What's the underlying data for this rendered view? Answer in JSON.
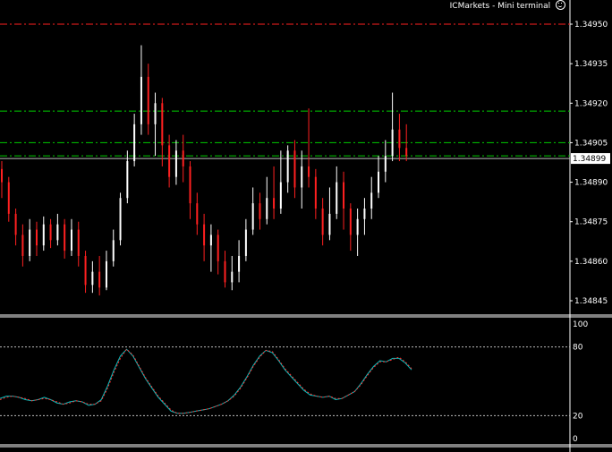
{
  "window": {
    "title": "ICMarkets - Mini terminal",
    "smiley_icon": "smiley-icon"
  },
  "colors": {
    "background": "#000000",
    "axis": "#ffffff",
    "bull": "#ffffff",
    "bear": "#ff2020",
    "resistance": "#ff2020",
    "support": "#00cc00",
    "current_price_line": "#bbbbbb",
    "osc_main": "#00c0c0",
    "osc_signal": "#ff3030",
    "osc_levels": "#bbbbbb"
  },
  "chart_data": [
    {
      "type": "candlestick",
      "price_axis_labels": [
        "1.34950",
        "1.34935",
        "1.34920",
        "1.34905",
        "1.34890",
        "1.34875",
        "1.34860",
        "1.34845"
      ],
      "current_price": "1.34899",
      "ylim": [
        1.34842,
        1.3496
      ],
      "horizontal_levels": [
        {
          "price": 1.3495,
          "style": "dash-dot",
          "color": "resistance"
        },
        {
          "price": 1.34917,
          "style": "dash-dot",
          "color": "support"
        },
        {
          "price": 1.34905,
          "style": "dash-dot",
          "color": "support"
        },
        {
          "price": 1.349,
          "style": "dash-dot",
          "color": "support"
        },
        {
          "price": 1.34899,
          "style": "solid",
          "color": "current_price_line"
        }
      ],
      "candles": [
        [
          1.34895,
          1.3489,
          1.34898,
          1.34884
        ],
        [
          1.3489,
          1.34878,
          1.34892,
          1.34875
        ],
        [
          1.34878,
          1.3487,
          1.3488,
          1.34866
        ],
        [
          1.3487,
          1.34862,
          1.34874,
          1.34858
        ],
        [
          1.34862,
          1.34872,
          1.34876,
          1.3486
        ],
        [
          1.34872,
          1.34866,
          1.34875,
          1.34862
        ],
        [
          1.34866,
          1.34874,
          1.34877,
          1.34864
        ],
        [
          1.34874,
          1.34868,
          1.34876,
          1.34865
        ],
        [
          1.34868,
          1.34874,
          1.34878,
          1.34866
        ],
        [
          1.34874,
          1.34864,
          1.34876,
          1.34861
        ],
        [
          1.34864,
          1.34872,
          1.34876,
          1.34862
        ],
        [
          1.34872,
          1.34862,
          1.34875,
          1.34858
        ],
        [
          1.34862,
          1.34851,
          1.34864,
          1.34848
        ],
        [
          1.34851,
          1.34856,
          1.3486,
          1.34848
        ],
        [
          1.34856,
          1.3485,
          1.34862,
          1.34847
        ],
        [
          1.3485,
          1.3486,
          1.34864,
          1.34849
        ],
        [
          1.3486,
          1.34868,
          1.34872,
          1.34858
        ],
        [
          1.34868,
          1.34884,
          1.34886,
          1.34866
        ],
        [
          1.34884,
          1.34898,
          1.34902,
          1.34882
        ],
        [
          1.34898,
          1.34912,
          1.34916,
          1.34896
        ],
        [
          1.34912,
          1.3493,
          1.34942,
          1.34908
        ],
        [
          1.3493,
          1.34912,
          1.34935,
          1.34908
        ],
        [
          1.34912,
          1.3492,
          1.34924,
          1.349
        ],
        [
          1.3492,
          1.34904,
          1.34922,
          1.34896
        ],
        [
          1.34904,
          1.34892,
          1.34908,
          1.34888
        ],
        [
          1.34892,
          1.34902,
          1.34906,
          1.34889
        ],
        [
          1.34902,
          1.34896,
          1.34908,
          1.3489
        ],
        [
          1.34896,
          1.34882,
          1.34898,
          1.34876
        ],
        [
          1.34882,
          1.34874,
          1.34886,
          1.3487
        ],
        [
          1.34874,
          1.34866,
          1.34878,
          1.3486
        ],
        [
          1.34866,
          1.3487,
          1.34874,
          1.34856
        ],
        [
          1.3487,
          1.3486,
          1.34872,
          1.34855
        ],
        [
          1.3486,
          1.34852,
          1.34864,
          1.3485
        ],
        [
          1.34852,
          1.34856,
          1.34862,
          1.34849
        ],
        [
          1.34856,
          1.34862,
          1.34868,
          1.34852
        ],
        [
          1.34862,
          1.34872,
          1.34876,
          1.3486
        ],
        [
          1.34872,
          1.34882,
          1.34888,
          1.3487
        ],
        [
          1.34882,
          1.34876,
          1.34886,
          1.34872
        ],
        [
          1.34876,
          1.34884,
          1.34892,
          1.34874
        ],
        [
          1.34884,
          1.3488,
          1.34896,
          1.34876
        ],
        [
          1.3488,
          1.3489,
          1.34902,
          1.34878
        ],
        [
          1.3489,
          1.34902,
          1.34904,
          1.34886
        ],
        [
          1.34902,
          1.34888,
          1.34906,
          1.34884
        ],
        [
          1.34888,
          1.34896,
          1.34902,
          1.3488
        ],
        [
          1.34896,
          1.34892,
          1.34918,
          1.34888
        ],
        [
          1.34892,
          1.3488,
          1.34895,
          1.34876
        ],
        [
          1.3488,
          1.3487,
          1.34884,
          1.34866
        ],
        [
          1.3487,
          1.34878,
          1.34888,
          1.34868
        ],
        [
          1.34878,
          1.3489,
          1.34896,
          1.34876
        ],
        [
          1.3489,
          1.3488,
          1.34894,
          1.34872
        ],
        [
          1.3488,
          1.3487,
          1.34882,
          1.34864
        ],
        [
          1.3487,
          1.34876,
          1.3488,
          1.34862
        ],
        [
          1.34876,
          1.3488,
          1.34884,
          1.3487
        ],
        [
          1.3488,
          1.34886,
          1.34892,
          1.34876
        ],
        [
          1.34886,
          1.34894,
          1.349,
          1.34884
        ],
        [
          1.34894,
          1.349,
          1.34906,
          1.3489
        ],
        [
          1.349,
          1.3491,
          1.34924,
          1.34898
        ],
        [
          1.3491,
          1.34903,
          1.34916,
          1.34898
        ],
        [
          1.34903,
          1.349,
          1.34912,
          1.34898
        ]
      ]
    },
    {
      "type": "line",
      "axis_labels": [
        "100",
        "80",
        "20",
        "0"
      ],
      "levels": [
        80,
        20
      ],
      "ylim": [
        0,
        100
      ],
      "series": [
        {
          "color": "osc_main",
          "values": [
            35,
            37,
            37,
            36,
            34,
            33,
            34,
            36,
            34,
            31,
            30,
            32,
            33,
            32,
            29,
            30,
            34,
            46,
            60,
            72,
            78,
            72,
            62,
            52,
            44,
            36,
            30,
            24,
            22,
            22,
            23,
            24,
            25,
            26,
            28,
            30,
            33,
            38,
            45,
            54,
            64,
            72,
            77,
            75,
            68,
            60,
            54,
            48,
            42,
            38,
            37,
            36,
            37,
            34,
            35,
            38,
            41,
            48,
            56,
            63,
            68,
            67,
            70,
            70,
            66,
            60
          ]
        },
        {
          "color": "osc_signal",
          "values": [
            34,
            36,
            37,
            36,
            35,
            33,
            34,
            35,
            34,
            32,
            30,
            31,
            33,
            32,
            30,
            30,
            33,
            44,
            58,
            70,
            78,
            73,
            63,
            53,
            45,
            37,
            31,
            25,
            22,
            22,
            23,
            24,
            25,
            26,
            28,
            30,
            33,
            37,
            44,
            53,
            63,
            71,
            77,
            76,
            69,
            61,
            55,
            49,
            43,
            39,
            37,
            36,
            37,
            35,
            35,
            38,
            41,
            47,
            55,
            62,
            67,
            67,
            69,
            71,
            67,
            61
          ]
        }
      ]
    }
  ]
}
